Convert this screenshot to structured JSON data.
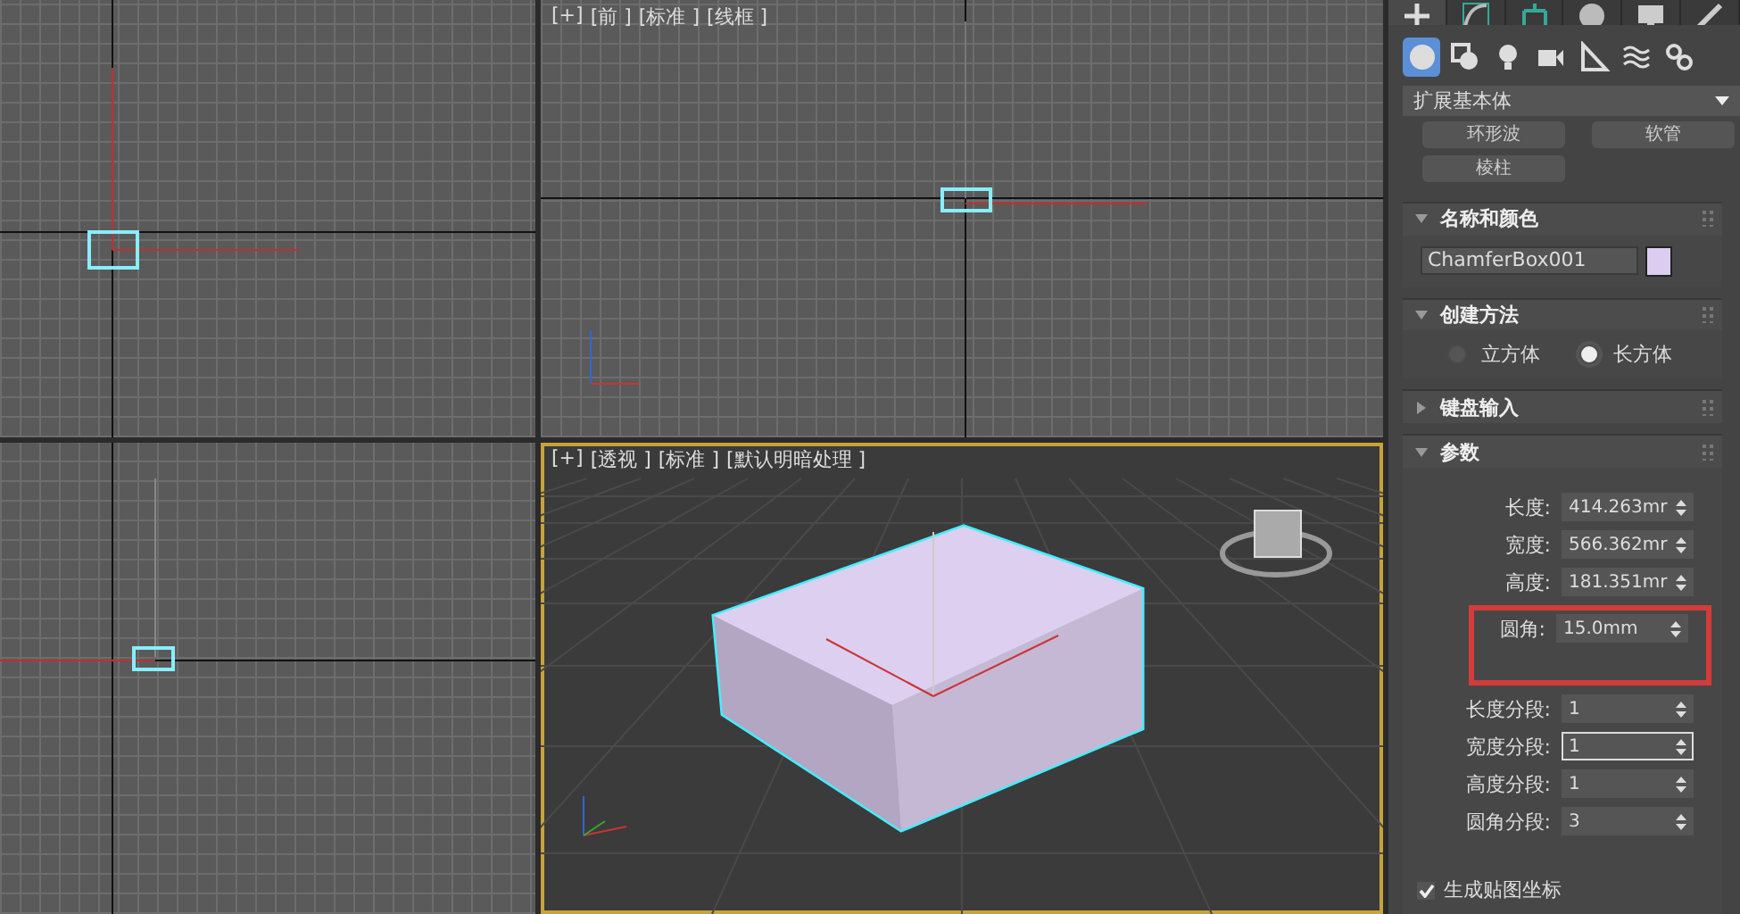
{
  "viewports": [
    {
      "kind": "top",
      "active": false
    },
    {
      "kind": "front",
      "active": false,
      "labels": [
        "[+]",
        "[前 ]",
        "[标准 ]",
        "[线框 ]"
      ]
    },
    {
      "kind": "left",
      "active": false
    },
    {
      "kind": "perspective",
      "active": true,
      "labels": [
        "[+]",
        "[透视 ]",
        "[标准 ]",
        "[默认明暗处理 ]"
      ]
    }
  ],
  "command_tabs": [
    {
      "kind": "create",
      "selected": true
    },
    {
      "kind": "modify",
      "selected": false
    },
    {
      "kind": "hierarchy",
      "selected": false
    },
    {
      "kind": "motion",
      "selected": false
    },
    {
      "kind": "display",
      "selected": false
    },
    {
      "kind": "utilities",
      "selected": false
    }
  ],
  "categories": [
    {
      "kind": "geometry",
      "selected": true
    },
    {
      "kind": "shapes",
      "selected": false
    },
    {
      "kind": "lights",
      "selected": false
    },
    {
      "kind": "cameras",
      "selected": false
    },
    {
      "kind": "helpers",
      "selected": false
    },
    {
      "kind": "spacewarps",
      "selected": false
    },
    {
      "kind": "systems",
      "selected": false
    }
  ],
  "dropdown": {
    "value": "扩展基本体"
  },
  "object_buttons": [
    "环形波",
    "软管",
    "棱柱"
  ],
  "rollouts": [
    {
      "kind": "name",
      "title": "名称和颜色",
      "expanded": true,
      "name_value": "ChamferBox001",
      "color": "#dccdf0"
    },
    {
      "kind": "method",
      "title": "创建方法",
      "expanded": true,
      "options": [
        {
          "label": "立方体",
          "selected": false
        },
        {
          "label": "长方体",
          "selected": true
        }
      ]
    },
    {
      "title": "键盘输入",
      "expanded": false
    },
    {
      "kind": "params",
      "title": "参数",
      "expanded": true,
      "rows": [
        {
          "kind": "spinner",
          "label": "长度:",
          "value": "414.263mr",
          "focused": false
        },
        {
          "kind": "spinner",
          "label": "宽度:",
          "value": "566.362mr",
          "focused": false
        },
        {
          "kind": "spinner",
          "label": "高度:",
          "value": "181.351mr",
          "focused": false
        },
        {
          "kind": "spinner",
          "label": "圆角:",
          "value": "15.0mm",
          "focused": false,
          "highlighted": true
        },
        {
          "kind": "spinner",
          "label": "长度分段:",
          "value": "1",
          "focused": false
        },
        {
          "kind": "spinner",
          "label": "宽度分段:",
          "value": "1",
          "focused": true
        },
        {
          "kind": "spinner",
          "label": "高度分段:",
          "value": "1",
          "focused": false
        },
        {
          "kind": "spinner",
          "label": "圆角分段:",
          "value": "3",
          "focused": false
        },
        {
          "kind": "checkbox",
          "label": "生成贴图坐标",
          "checked": true
        }
      ]
    }
  ]
}
